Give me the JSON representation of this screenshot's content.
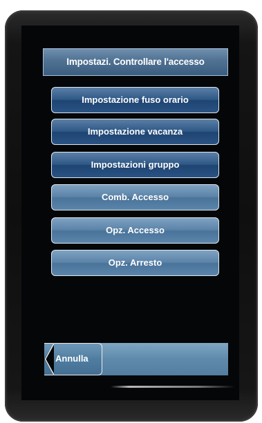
{
  "header": {
    "title": "Impostazi. Controllare l'accesso"
  },
  "menu": {
    "items": [
      {
        "label": "Impostazione fuso orario"
      },
      {
        "label": "Impostazione vacanza"
      },
      {
        "label": "Impostazioni gruppo"
      },
      {
        "label": "Comb. Accesso"
      },
      {
        "label": "Opz. Accesso"
      },
      {
        "label": "Opz. Arresto"
      }
    ]
  },
  "footer": {
    "cancel_label": "Annulla"
  },
  "colors": {
    "accent_dark": "#2e5886",
    "accent_light": "#5b83a8",
    "screen_bg": "#050608"
  }
}
